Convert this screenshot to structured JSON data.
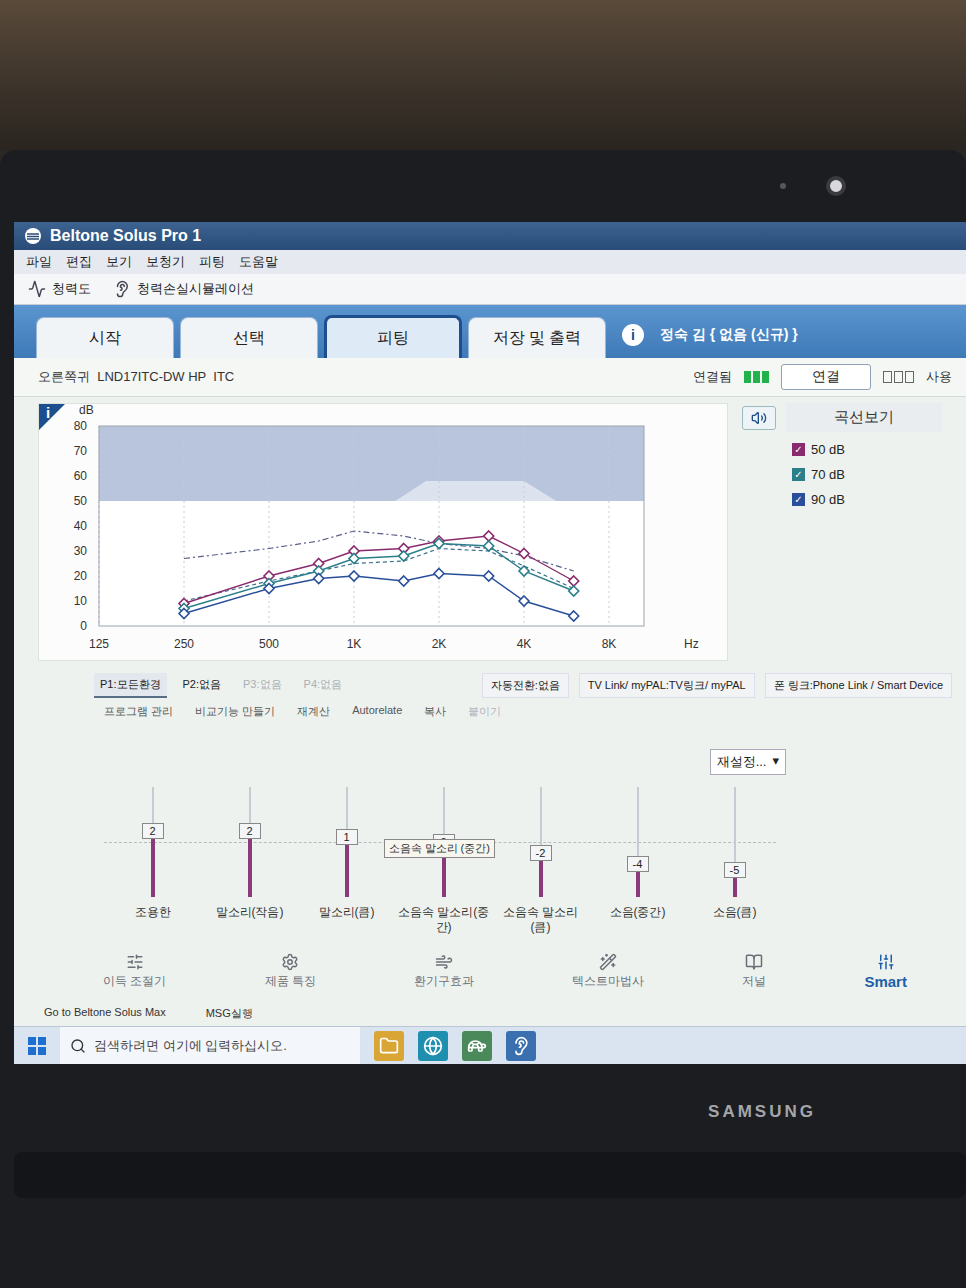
{
  "window": {
    "title": "Beltone Solus Pro 1"
  },
  "menu": [
    "파일",
    "편집",
    "보기",
    "보청기",
    "피팅",
    "도움말"
  ],
  "toolbar": [
    {
      "label": "청력도"
    },
    {
      "label": "청력손실시뮬레이션"
    }
  ],
  "tabs": [
    {
      "label": "시작",
      "selected": false
    },
    {
      "label": "선택",
      "selected": false
    },
    {
      "label": "피팅",
      "selected": true
    },
    {
      "label": "저장 및 출력",
      "selected": false
    }
  ],
  "info_icon": "i",
  "patient": "정숙 김 { 없음 (신규) }",
  "device": {
    "label": "오른쪽귀  LND17ITC-DW HP  ITC",
    "status": "연결됨",
    "connected": true,
    "connect_button": "연결",
    "usage": "사용"
  },
  "chart": {
    "info_icon": "i",
    "y_unit": "dB",
    "x_unit": "Hz",
    "y_ticks": [
      "80",
      "70",
      "60",
      "50",
      "40",
      "30",
      "20",
      "10",
      "0"
    ],
    "x_ticks": [
      "125",
      "250",
      "500",
      "1K",
      "2K",
      "4K",
      "8K"
    ],
    "frequencies": [
      250,
      500,
      750,
      1000,
      1500,
      2000,
      3000,
      4000,
      6000
    ],
    "series": [
      {
        "label": "50 dB",
        "checked": true,
        "color": "#8a2a6e",
        "values": [
          9,
          20,
          25,
          30,
          31,
          34,
          36,
          29,
          18
        ]
      },
      {
        "label": "70 dB",
        "checked": true,
        "color": "#2a7f8a",
        "values": [
          7,
          17,
          22,
          27,
          28,
          33,
          32,
          22,
          14
        ]
      },
      {
        "label": "90 dB",
        "checked": true,
        "color": "#2a4f9a",
        "values": [
          5,
          15,
          19,
          20,
          18,
          21,
          20,
          10,
          4
        ]
      }
    ],
    "targets": [
      {
        "color": "#5a5f8a",
        "values": [
          27,
          31,
          34,
          38,
          36,
          33,
          31,
          28,
          22
        ]
      },
      {
        "color": "#3a6f8a",
        "values": [
          10,
          18,
          22,
          25,
          26,
          31,
          30,
          24,
          15
        ]
      }
    ]
  },
  "legend": {
    "title": "곡선보기"
  },
  "programs": [
    {
      "label": "P1:모든환경",
      "selected": true,
      "disabled": false
    },
    {
      "label": "P2:없음",
      "selected": false,
      "disabled": false
    },
    {
      "label": "P3:없음",
      "selected": false,
      "disabled": true
    },
    {
      "label": "P4:없음",
      "selected": false,
      "disabled": true
    }
  ],
  "program_links": [
    "자동전환:없음",
    "TV Link/ myPAL:TV링크/ myPAL",
    "폰 링크:Phone Link / Smart Device"
  ],
  "actions": [
    {
      "label": "프로그램 관리",
      "disabled": false
    },
    {
      "label": "비교기능 만들기",
      "disabled": false
    },
    {
      "label": "재계산",
      "disabled": false
    },
    {
      "label": "Autorelate",
      "disabled": false
    },
    {
      "label": "복사",
      "disabled": false
    },
    {
      "label": "붙이기",
      "disabled": true
    }
  ],
  "reset": {
    "label": "재설정...",
    "arrow": "▾"
  },
  "tooltip": "소음속 말소리 (중간)",
  "sliders": [
    {
      "label": "조용한",
      "value": "2",
      "level": 0.6,
      "hovered": false
    },
    {
      "label": "말소리(작음)",
      "value": "2",
      "level": 0.6,
      "hovered": false
    },
    {
      "label": "말소리(큼)",
      "value": "1",
      "level": 0.55,
      "hovered": false
    },
    {
      "label": "소음속 말소리(중간)",
      "value": "0",
      "level": 0.5,
      "hovered": true
    },
    {
      "label": "소음속 말소리(큼)",
      "value": "-2",
      "level": 0.4,
      "hovered": false
    },
    {
      "label": "소음(중간)",
      "value": "-4",
      "level": 0.3,
      "hovered": false
    },
    {
      "label": "소음(큼)",
      "value": "-5",
      "level": 0.25,
      "hovered": false
    }
  ],
  "nav": [
    {
      "label": "이득 조절기",
      "emphasis": false
    },
    {
      "label": "제품 특징",
      "emphasis": false
    },
    {
      "label": "환기구효과",
      "emphasis": false
    },
    {
      "label": "텍스트마법사",
      "emphasis": false
    },
    {
      "label": "저널",
      "emphasis": false
    },
    {
      "label": "Smart",
      "emphasis": true
    }
  ],
  "footer": [
    "Go to Beltone Solus Max",
    "MSG실행"
  ],
  "taskbar": {
    "search_placeholder": "검색하려면 여기에 입력하십시오."
  },
  "laptop": {
    "brand": "SAMSUNG"
  }
}
